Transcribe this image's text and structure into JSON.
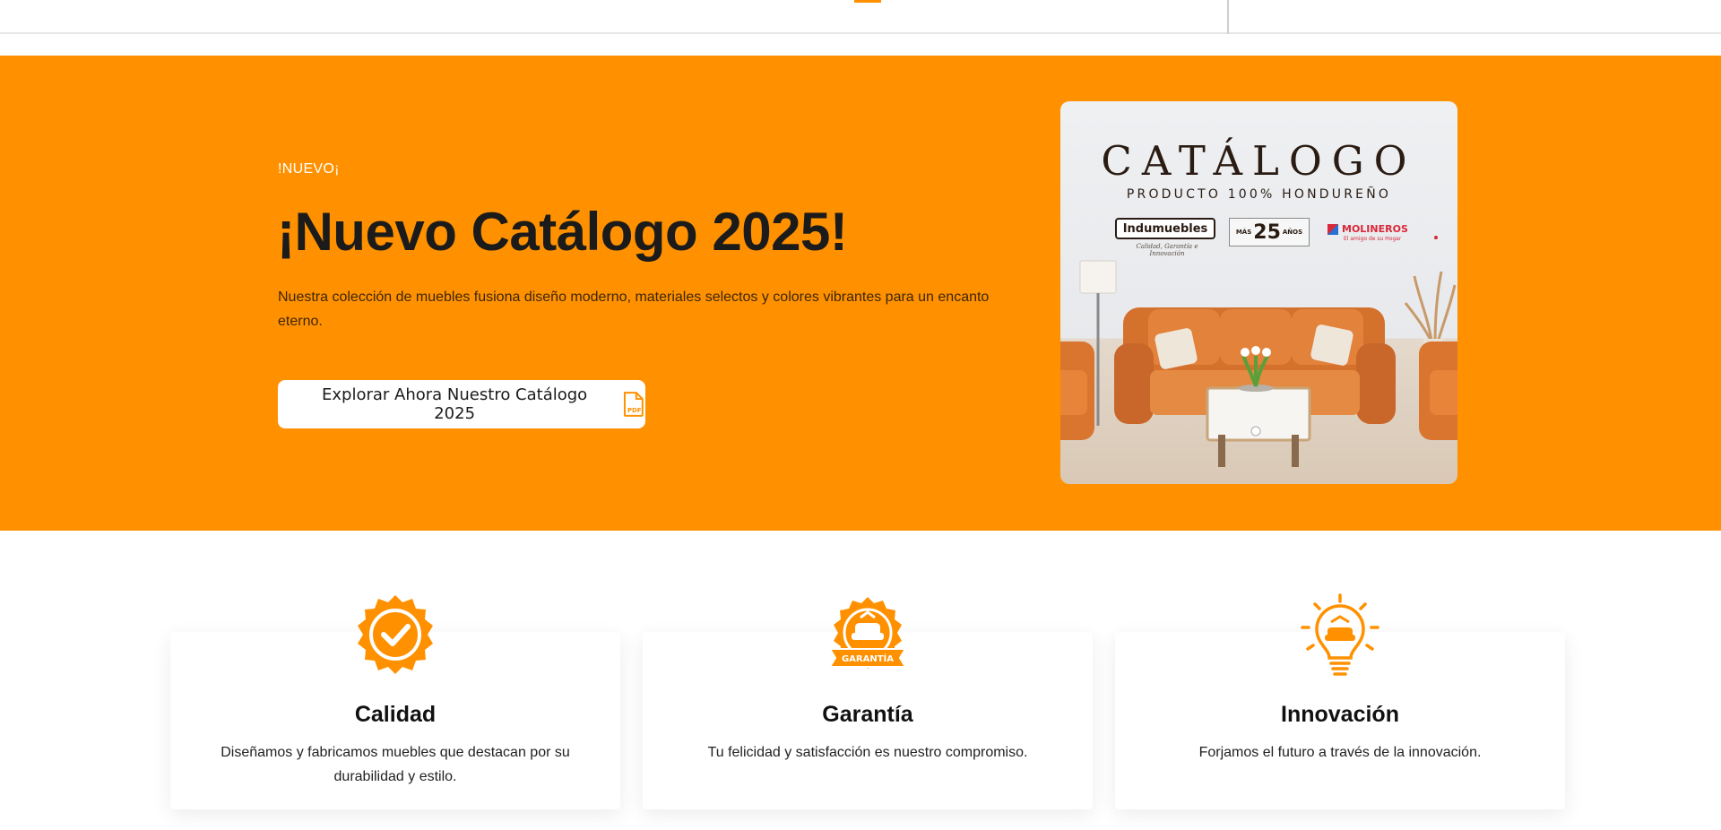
{
  "colors": {
    "brand_orange": "#ff9100",
    "text_dark": "#1b1b1b",
    "white": "#ffffff"
  },
  "hero": {
    "tag": "!NUEVO¡",
    "title": "¡Nuevo Catálogo 2025!",
    "description": "Nuestra colección de muebles fusiona diseño moderno, materiales selectos y colores vibrantes para un encanto eterno.",
    "button_label": "Explorar Ahora Nuestro Catálogo 2025",
    "button_icon": "pdf-file-icon",
    "catalog_image": {
      "title": "CATÁLOGO",
      "subtitle": "PRODUCTO 100% HONDUREÑO",
      "brand_indumuebles": "Indumuebles",
      "brand_indumuebles_tagline": "Calidad, Garantía e Innovación",
      "brand_years_prefix": "MÁS",
      "brand_years_number": "25",
      "brand_years_suffix": "AÑOS",
      "brand_molineros": "MOLINEROS",
      "brand_molineros_tagline": "El amigo de su Hogar"
    }
  },
  "features": [
    {
      "icon": "quality-check-badge-icon",
      "title": "Calidad",
      "text": "Diseñamos y fabricamos muebles que destacan por su durabilidad y estilo."
    },
    {
      "icon": "warranty-seal-icon",
      "title": "Garantía",
      "text": "Tu felicidad y satisfacción es nuestro compromiso.",
      "badge_text": "GARANTÍA"
    },
    {
      "icon": "innovation-lightbulb-icon",
      "title": "Innovación",
      "text": "Forjamos el futuro a través de la innovación."
    }
  ]
}
